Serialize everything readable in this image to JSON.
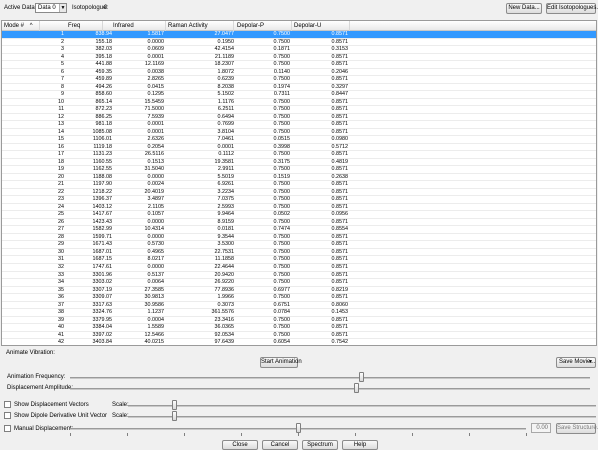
{
  "topbar": {
    "active_data_label": "Active Data:",
    "active_data_value": "Data 0",
    "isotopologue_label": "Isotopologue:",
    "isotopologue_value": "0",
    "new_data_label": "New Data...",
    "edit_isotopologues_label": "Edit Isotopologues..."
  },
  "table": {
    "headers": [
      "Mode #",
      "Freq",
      "Infrared",
      "Raman Activity",
      "Depolar-P",
      "Depolar-U"
    ],
    "sort_indicator": "^",
    "selected_row": 0,
    "rows": [
      [
        "1",
        "838.94",
        "1.5817",
        "27.0477",
        "0.7500",
        "0.8571"
      ],
      [
        "2",
        "155.18",
        "0.0000",
        "0.1950",
        "0.7500",
        "0.8571"
      ],
      [
        "3",
        "382.03",
        "0.0609",
        "42.4154",
        "0.1871",
        "0.3153"
      ],
      [
        "4",
        "395.18",
        "0.0001",
        "21.1189",
        "0.7500",
        "0.8571"
      ],
      [
        "5",
        "441.88",
        "12.1169",
        "18.2307",
        "0.7500",
        "0.8571"
      ],
      [
        "6",
        "459.35",
        "0.0038",
        "1.8072",
        "0.1140",
        "0.2046"
      ],
      [
        "7",
        "459.89",
        "2.8265",
        "0.6239",
        "0.7500",
        "0.8571"
      ],
      [
        "8",
        "494.26",
        "0.0415",
        "8.2038",
        "0.1974",
        "0.3297"
      ],
      [
        "9",
        "858.60",
        "0.1295",
        "5.1502",
        "0.7311",
        "0.8447"
      ],
      [
        "10",
        "865.14",
        "15.5459",
        "1.1176",
        "0.7500",
        "0.8571"
      ],
      [
        "11",
        "872.23",
        "71.5000",
        "6.2511",
        "0.7500",
        "0.8571"
      ],
      [
        "12",
        "886.25",
        "7.5939",
        "0.6494",
        "0.7500",
        "0.8571"
      ],
      [
        "13",
        "981.18",
        "0.0001",
        "0.7699",
        "0.7500",
        "0.8571"
      ],
      [
        "14",
        "1085.08",
        "0.0001",
        "3.8104",
        "0.7500",
        "0.8571"
      ],
      [
        "15",
        "1106.01",
        "2.6326",
        "7.0461",
        "0.0515",
        "0.0980"
      ],
      [
        "16",
        "1119.18",
        "0.2054",
        "0.0001",
        "0.3998",
        "0.5712"
      ],
      [
        "17",
        "1131.23",
        "26.5116",
        "0.1112",
        "0.7500",
        "0.8571"
      ],
      [
        "18",
        "1160.55",
        "0.1513",
        "19.3581",
        "0.3175",
        "0.4819"
      ],
      [
        "19",
        "1162.55",
        "31.5040",
        "2.9911",
        "0.7500",
        "0.8571"
      ],
      [
        "20",
        "1188.08",
        "0.0000",
        "5.5019",
        "0.1519",
        "0.2638"
      ],
      [
        "21",
        "1197.90",
        "0.0024",
        "6.9261",
        "0.7500",
        "0.8571"
      ],
      [
        "22",
        "1218.22",
        "20.4019",
        "3.2234",
        "0.7500",
        "0.8571"
      ],
      [
        "23",
        "1396.37",
        "3.4897",
        "7.0375",
        "0.7500",
        "0.8571"
      ],
      [
        "24",
        "1403.12",
        "2.1105",
        "2.5993",
        "0.7500",
        "0.8571"
      ],
      [
        "25",
        "1417.67",
        "0.1057",
        "9.9464",
        "0.0502",
        "0.0956"
      ],
      [
        "26",
        "1423.43",
        "0.0000",
        "8.9159",
        "0.7500",
        "0.8571"
      ],
      [
        "27",
        "1582.99",
        "10.4314",
        "0.0181",
        "0.7474",
        "0.8554"
      ],
      [
        "28",
        "1599.71",
        "0.0000",
        "9.3544",
        "0.7500",
        "0.8571"
      ],
      [
        "29",
        "1671.43",
        "0.5730",
        "3.5300",
        "0.7500",
        "0.8571"
      ],
      [
        "30",
        "1687.01",
        "0.4965",
        "22.7531",
        "0.7500",
        "0.8571"
      ],
      [
        "31",
        "1687.15",
        "8.0217",
        "11.1858",
        "0.7500",
        "0.8571"
      ],
      [
        "32",
        "1747.61",
        "0.0000",
        "22.4644",
        "0.7500",
        "0.8571"
      ],
      [
        "33",
        "3301.96",
        "0.5137",
        "20.9420",
        "0.7500",
        "0.8571"
      ],
      [
        "34",
        "3303.02",
        "0.0064",
        "26.9220",
        "0.7500",
        "0.8571"
      ],
      [
        "35",
        "3307.19",
        "27.3585",
        "77.8936",
        "0.6977",
        "0.8219"
      ],
      [
        "36",
        "3309.07",
        "30.9813",
        "1.9966",
        "0.7500",
        "0.8571"
      ],
      [
        "37",
        "3317.63",
        "30.9586",
        "0.3073",
        "0.6751",
        "0.8060"
      ],
      [
        "38",
        "3324.76",
        "1.1237",
        "361.5576",
        "0.0784",
        "0.1453"
      ],
      [
        "39",
        "3379.95",
        "0.0004",
        "23.3416",
        "0.7500",
        "0.8571"
      ],
      [
        "40",
        "3384.04",
        "1.5589",
        "36.0365",
        "0.7500",
        "0.8571"
      ],
      [
        "41",
        "3397.02",
        "12.5466",
        "92.0534",
        "0.7500",
        "0.8571"
      ],
      [
        "42",
        "3403.84",
        "40.0215",
        "97.6439",
        "0.6054",
        "0.7542"
      ]
    ]
  },
  "animate": {
    "section_label": "Animate Vibration:",
    "start_label": "Start Animation",
    "save_movie_label": "Save Movie...",
    "frequency_label": "Animation Frequency:",
    "amplitude_label": "Displacement Amplitude:",
    "frequency_level": 0.56,
    "amplitude_level": 0.55
  },
  "options": {
    "show_displacement_label": "Show Displacement Vectors",
    "show_dipole_label": "Show Dipole Derivative Unit Vector",
    "scale_label": "Scale:",
    "manual_displacement_label": "Manual Displacement:",
    "manual_value": "0.00",
    "save_structure_label": "Save Structure...",
    "displacement_scale_level": 0.1,
    "dipole_scale_level": 0.1,
    "manual_level": 0.5
  },
  "footer": {
    "close_label": "Close",
    "cancel_label": "Cancel",
    "spectrum_label": "Spectrum",
    "help_label": "Help"
  }
}
